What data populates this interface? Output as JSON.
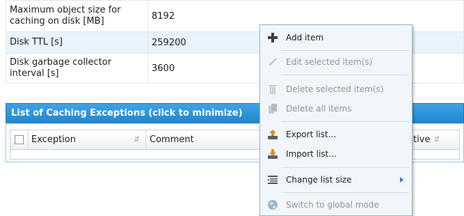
{
  "settings": {
    "rows": [
      {
        "label": "Maximum object size for caching on disk [MB]",
        "value": "8192"
      },
      {
        "label": "Disk TTL [s]",
        "value": "259200"
      },
      {
        "label": "Disk garbage collector interval [s]",
        "value": "3600"
      }
    ]
  },
  "panel": {
    "title": "List of Caching Exceptions (click to minimize)",
    "columns": [
      "Exception",
      "Comment",
      "tive"
    ]
  },
  "menu": {
    "add_item": "Add item",
    "edit_selected": "Edit selected item(s)",
    "delete_selected": "Delete selected item(s)",
    "delete_all": "Delete all items",
    "export_list": "Export list...",
    "import_list": "Import list...",
    "change_list_size": "Change list size",
    "switch_global": "Switch to global mode"
  },
  "colors": {
    "header_blue": "#1f86cf",
    "row_highlight": "#e9f3fb",
    "menu_bg": "#f1f6fa"
  }
}
